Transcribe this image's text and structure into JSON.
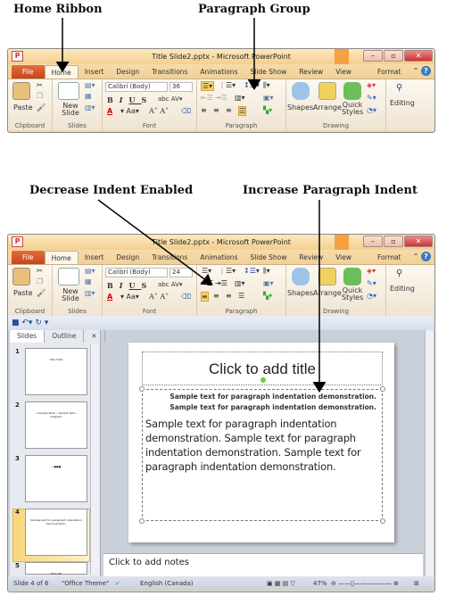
{
  "annotations": {
    "home_ribbon": "Home Ribbon",
    "paragraph_group": "Paragraph Group",
    "decrease_indent": "Decrease Indent Enabled",
    "increase_indent": "Increase Paragraph Indent"
  },
  "window1": {
    "title": "Title Slide2.pptx - Microsoft PowerPoint",
    "font_name": "Calibri (Body)",
    "font_size": "36"
  },
  "window2": {
    "title": "Title Slide2.pptx - Microsoft PowerPoint",
    "font_name": "Calibri (Body)",
    "font_size": "24",
    "pane_tabs": [
      "Slides",
      "Outline"
    ],
    "thumbnails": [
      {
        "num": "1",
        "text": "Title Slide"
      },
      {
        "num": "2",
        "text": "• Sample Slide • Sample Text • Diagram"
      },
      {
        "num": "3",
        "text": "• ●●●"
      },
      {
        "num": "4",
        "text": "Sample text for paragraph indentation demonstration."
      },
      {
        "num": "5",
        "text": "Slide #5"
      }
    ],
    "slide_title": "Click to add title",
    "indented_lines": [
      "Sample text for paragraph indentation demonstration.",
      "Sample text for paragraph indentation demonstration."
    ],
    "body_text": "Sample text for paragraph indentation demonstration. Sample text for paragraph indentation demonstration. Sample text for paragraph indentation demonstration.",
    "notes": "Click to add notes",
    "status": {
      "slide": "Slide 4 of 6",
      "theme": "\"Office Theme\"",
      "language": "English (Canada)",
      "zoom": "47%"
    }
  },
  "tabs": [
    "File",
    "Home",
    "Insert",
    "Design",
    "Transitions",
    "Animations",
    "Slide Show",
    "Review",
    "View",
    "Format"
  ],
  "groups": {
    "clipboard": "Clipboard",
    "slides": "Slides",
    "font": "Font",
    "paragraph": "Paragraph",
    "drawing": "Drawing",
    "editing": "Editing"
  },
  "buttons": {
    "paste": "Paste",
    "new_slide": "New Slide",
    "shapes": "Shapes",
    "arrange": "Arrange",
    "quick_styles": "Quick Styles",
    "editing": "Editing"
  },
  "colors": {
    "file_tab": "#d4562a",
    "selected": "#fbd56b",
    "accent": "#3a78c8"
  }
}
